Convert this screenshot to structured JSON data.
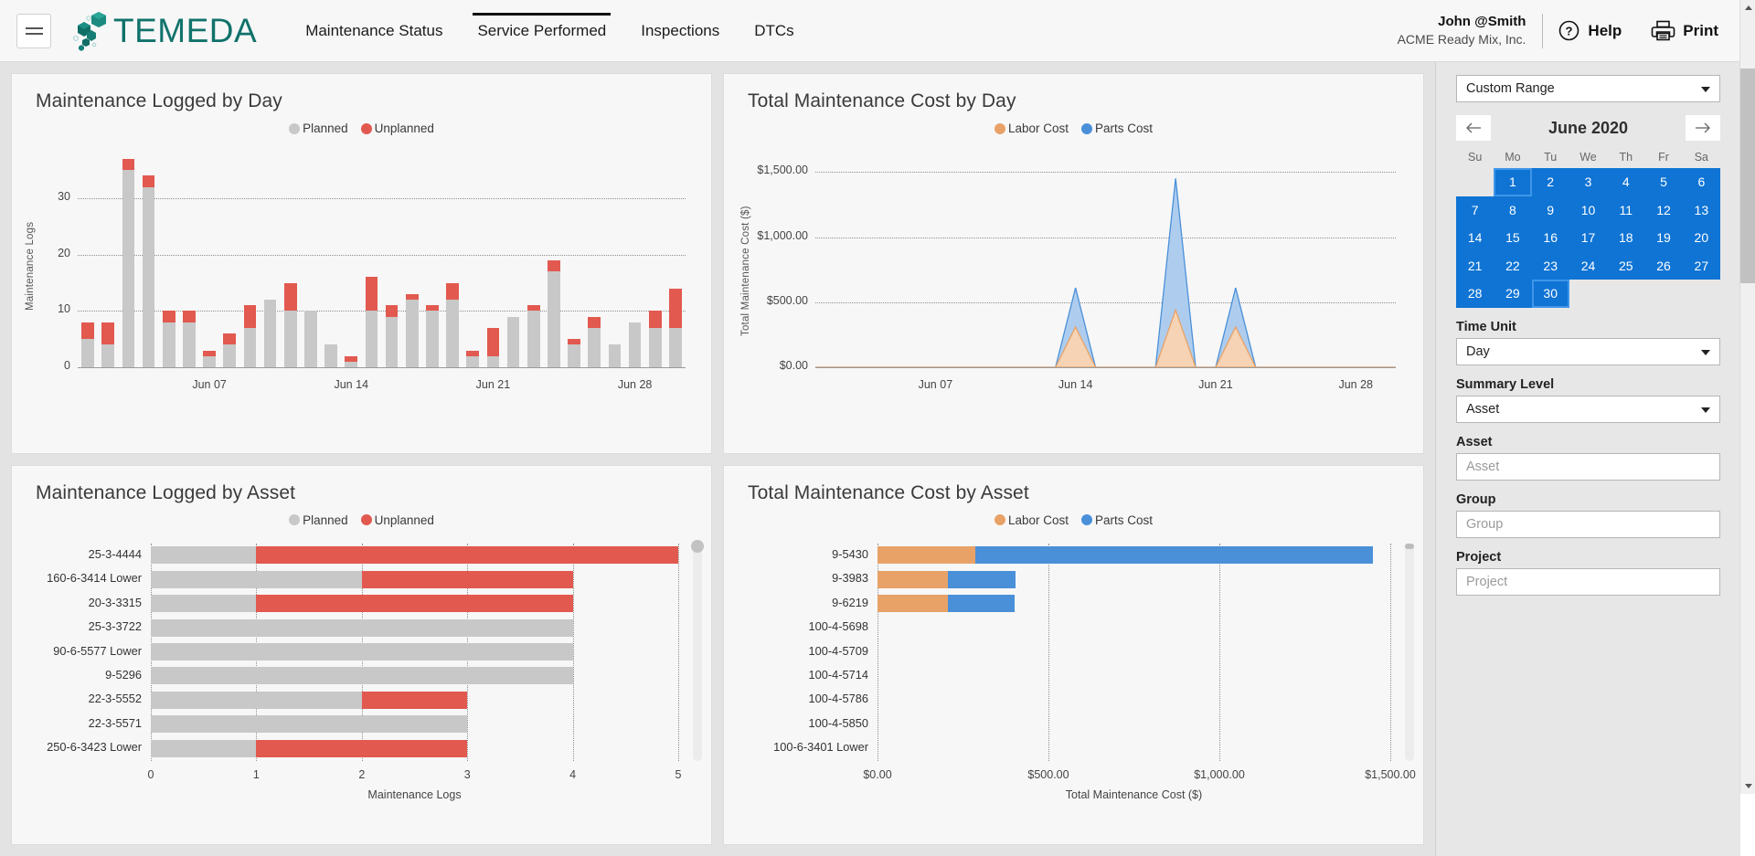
{
  "header": {
    "menu_icon": "hamburger-icon",
    "logo_text": "TEMEDA",
    "nav": [
      {
        "label": "Maintenance Status",
        "active": false
      },
      {
        "label": "Service Performed",
        "active": true
      },
      {
        "label": "Inspections",
        "active": false
      },
      {
        "label": "DTCs",
        "active": false
      }
    ],
    "user_name": "John @Smith",
    "user_org": "ACME Ready Mix, Inc.",
    "help_label": "Help",
    "help_icon": "question-circle-icon",
    "print_label": "Print",
    "print_icon": "printer-icon"
  },
  "sidebar": {
    "range_select": {
      "value": "Custom Range",
      "icon": "chevron-down-icon"
    },
    "calendar": {
      "title": "June 2020",
      "prev_icon": "arrow-left-icon",
      "next_icon": "arrow-right-icon",
      "dow": [
        "Su",
        "Mo",
        "Tu",
        "We",
        "Th",
        "Fr",
        "Sa"
      ],
      "lead_blanks": 1,
      "days": [
        1,
        2,
        3,
        4,
        5,
        6,
        7,
        8,
        9,
        10,
        11,
        12,
        13,
        14,
        15,
        16,
        17,
        18,
        19,
        20,
        21,
        22,
        23,
        24,
        25,
        26,
        27,
        28,
        29,
        30
      ],
      "selected_start": 1,
      "selected_end": 30
    },
    "fields": [
      {
        "label": "Time Unit",
        "type": "select",
        "value": "Day",
        "placeholder": ""
      },
      {
        "label": "Summary Level",
        "type": "select",
        "value": "Asset",
        "placeholder": ""
      },
      {
        "label": "Asset",
        "type": "text",
        "value": "",
        "placeholder": "Asset"
      },
      {
        "label": "Group",
        "type": "text",
        "value": "",
        "placeholder": "Group"
      },
      {
        "label": "Project",
        "type": "text",
        "value": "",
        "placeholder": "Project"
      }
    ]
  },
  "colors": {
    "planned": "#c8c8c8",
    "unplanned": "#e2594f",
    "labor": "#e8a268",
    "parts": "#4a90d9",
    "labor_fill": "#f5d3b4",
    "parts_fill": "#aecdee",
    "brand": "#11726b",
    "calendar_selected": "#0f74d4"
  },
  "chart_data": [
    {
      "id": "maintenance-logged-by-day",
      "type": "bar",
      "stacked": true,
      "title": "Maintenance Logged by Day",
      "xlabel": "",
      "ylabel": "Maintenance Logs",
      "ylim": [
        0,
        37
      ],
      "yticks": [
        0,
        10,
        20,
        30
      ],
      "grid": true,
      "legend": [
        {
          "name": "Planned",
          "color": "#c8c8c8"
        },
        {
          "name": "Unplanned",
          "color": "#e2594f"
        }
      ],
      "xticklabels": [
        "Jun 07",
        "Jun 14",
        "Jun 21",
        "Jun 28"
      ],
      "xtick_indices": [
        6,
        13,
        20,
        27
      ],
      "categories": [
        "Jun 01",
        "Jun 02",
        "Jun 03",
        "Jun 04",
        "Jun 05",
        "Jun 06",
        "Jun 07",
        "Jun 08",
        "Jun 09",
        "Jun 10",
        "Jun 11",
        "Jun 12",
        "Jun 13",
        "Jun 14",
        "Jun 15",
        "Jun 16",
        "Jun 17",
        "Jun 18",
        "Jun 19",
        "Jun 20",
        "Jun 21",
        "Jun 22",
        "Jun 23",
        "Jun 24",
        "Jun 25",
        "Jun 26",
        "Jun 27",
        "Jun 28",
        "Jun 29",
        "Jun 30"
      ],
      "series": [
        {
          "name": "Planned",
          "values": [
            5,
            4,
            35,
            32,
            8,
            8,
            2,
            4,
            7,
            12,
            10,
            10,
            4,
            1,
            10,
            9,
            12,
            10,
            12,
            2,
            2,
            9,
            10,
            17,
            4,
            7,
            4,
            8,
            7,
            7
          ]
        },
        {
          "name": "Unplanned",
          "values": [
            3,
            4,
            2,
            2,
            2,
            2,
            1,
            2,
            4,
            0,
            5,
            0,
            0,
            1,
            6,
            2,
            1,
            1,
            3,
            1,
            5,
            0,
            1,
            2,
            1,
            2,
            0,
            0,
            3,
            7
          ]
        }
      ]
    },
    {
      "id": "total-maintenance-cost-by-day",
      "type": "area",
      "stacked": false,
      "title": "Total Maintenance Cost by Day",
      "xlabel": "",
      "ylabel": "Total Maintenance Cost ($)",
      "ylim": [
        0,
        1600
      ],
      "yticks": [
        0,
        500,
        1000,
        1500
      ],
      "yticklabels": [
        "$0.00",
        "$500.00",
        "$1,000.00",
        "$1,500.00"
      ],
      "grid": true,
      "legend": [
        {
          "name": "Labor Cost",
          "color": "#e8a268"
        },
        {
          "name": "Parts Cost",
          "color": "#4a90d9"
        }
      ],
      "xticklabels": [
        "Jun 07",
        "Jun 14",
        "Jun 21",
        "Jun 28"
      ],
      "xtick_indices": [
        6,
        13,
        20,
        27
      ],
      "categories": [
        "Jun 01",
        "Jun 02",
        "Jun 03",
        "Jun 04",
        "Jun 05",
        "Jun 06",
        "Jun 07",
        "Jun 08",
        "Jun 09",
        "Jun 10",
        "Jun 11",
        "Jun 12",
        "Jun 13",
        "Jun 14",
        "Jun 15",
        "Jun 16",
        "Jun 17",
        "Jun 18",
        "Jun 19",
        "Jun 20",
        "Jun 21",
        "Jun 22",
        "Jun 23",
        "Jun 24",
        "Jun 25",
        "Jun 26",
        "Jun 27",
        "Jun 28",
        "Jun 29",
        "Jun 30"
      ],
      "series": [
        {
          "name": "Parts Cost",
          "values": [
            0,
            0,
            0,
            0,
            0,
            0,
            0,
            0,
            0,
            0,
            0,
            0,
            0,
            610,
            0,
            0,
            0,
            0,
            1450,
            0,
            0,
            610,
            0,
            0,
            0,
            0,
            0,
            0,
            0,
            0
          ]
        },
        {
          "name": "Labor Cost",
          "values": [
            0,
            0,
            0,
            0,
            0,
            0,
            0,
            0,
            0,
            0,
            0,
            0,
            0,
            310,
            0,
            0,
            0,
            0,
            440,
            0,
            0,
            310,
            0,
            0,
            0,
            0,
            0,
            0,
            0,
            0
          ]
        }
      ]
    },
    {
      "id": "maintenance-logged-by-asset",
      "type": "bar",
      "orientation": "horizontal",
      "stacked": true,
      "title": "Maintenance Logged by Asset",
      "xlabel": "Maintenance Logs",
      "ylabel": "",
      "xlim": [
        0,
        5
      ],
      "xticks": [
        0,
        1,
        2,
        3,
        4,
        5
      ],
      "grid": true,
      "legend": [
        {
          "name": "Planned",
          "color": "#c8c8c8"
        },
        {
          "name": "Unplanned",
          "color": "#e2594f"
        }
      ],
      "categories": [
        "25-3-4444",
        "160-6-3414 Lower",
        "20-3-3315",
        "25-3-3722",
        "90-6-5577 Lower",
        "9-5296",
        "22-3-5552",
        "22-3-5571",
        "250-6-3423 Lower"
      ],
      "series": [
        {
          "name": "Planned",
          "values": [
            1,
            2,
            1,
            4,
            4,
            4,
            2,
            3,
            1
          ]
        },
        {
          "name": "Unplanned",
          "values": [
            4,
            2,
            3,
            0,
            0,
            0,
            1,
            0,
            2
          ]
        }
      ]
    },
    {
      "id": "total-maintenance-cost-by-asset",
      "type": "bar",
      "orientation": "horizontal",
      "stacked": true,
      "title": "Total Maintenance Cost by Asset",
      "xlabel": "Total Maintenance Cost ($)",
      "ylabel": "",
      "xlim": [
        0,
        1500
      ],
      "xticks": [
        0,
        500,
        1000,
        1500
      ],
      "xticklabels": [
        "$0.00",
        "$500.00",
        "$1,000.00",
        "$1,500.00"
      ],
      "grid": true,
      "legend": [
        {
          "name": "Labor Cost",
          "color": "#e8a268"
        },
        {
          "name": "Parts Cost",
          "color": "#4a90d9"
        }
      ],
      "categories": [
        "9-5430",
        "9-3983",
        "9-6219",
        "100-4-5698",
        "100-4-5709",
        "100-4-5714",
        "100-4-5786",
        "100-4-5850",
        "100-6-3401 Lower"
      ],
      "series": [
        {
          "name": "Labor Cost",
          "values": [
            285,
            205,
            205,
            0,
            0,
            0,
            0,
            0,
            0
          ]
        },
        {
          "name": "Parts Cost",
          "values": [
            1165,
            200,
            195,
            0,
            0,
            0,
            0,
            0,
            0
          ]
        }
      ]
    }
  ]
}
